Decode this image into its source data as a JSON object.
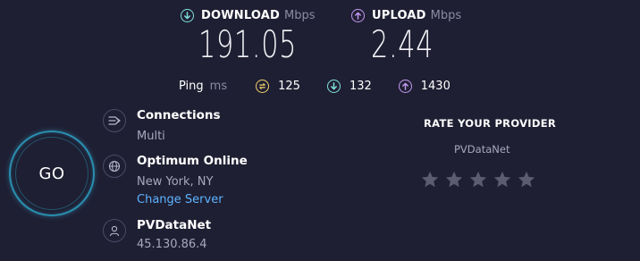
{
  "download": {
    "label": "DOWNLOAD",
    "unit": "Mbps",
    "value": "191.05",
    "icon": "arrow-down-circle-icon",
    "color": "#7fe3de"
  },
  "upload": {
    "label": "UPLOAD",
    "unit": "Mbps",
    "value": "2.44",
    "icon": "arrow-up-circle-icon",
    "color": "#c39af2"
  },
  "ping": {
    "label": "Ping",
    "unit": "ms",
    "idle": "125",
    "download": "132",
    "upload": "1430",
    "idle_color": "#f1d36b"
  },
  "go_button": {
    "label": "GO"
  },
  "connections": {
    "title": "Connections",
    "value": "Multi",
    "icon": "connections-icon"
  },
  "server": {
    "title": "Optimum Online",
    "location": "New York, NY",
    "change_label": "Change Server",
    "icon": "globe-icon"
  },
  "provider": {
    "title": "PVDataNet",
    "ip": "45.130.86.4",
    "icon": "user-icon"
  },
  "rating": {
    "title": "RATE YOUR PROVIDER",
    "provider": "PVDataNet",
    "stars_total": 5,
    "stars_selected": 0
  }
}
